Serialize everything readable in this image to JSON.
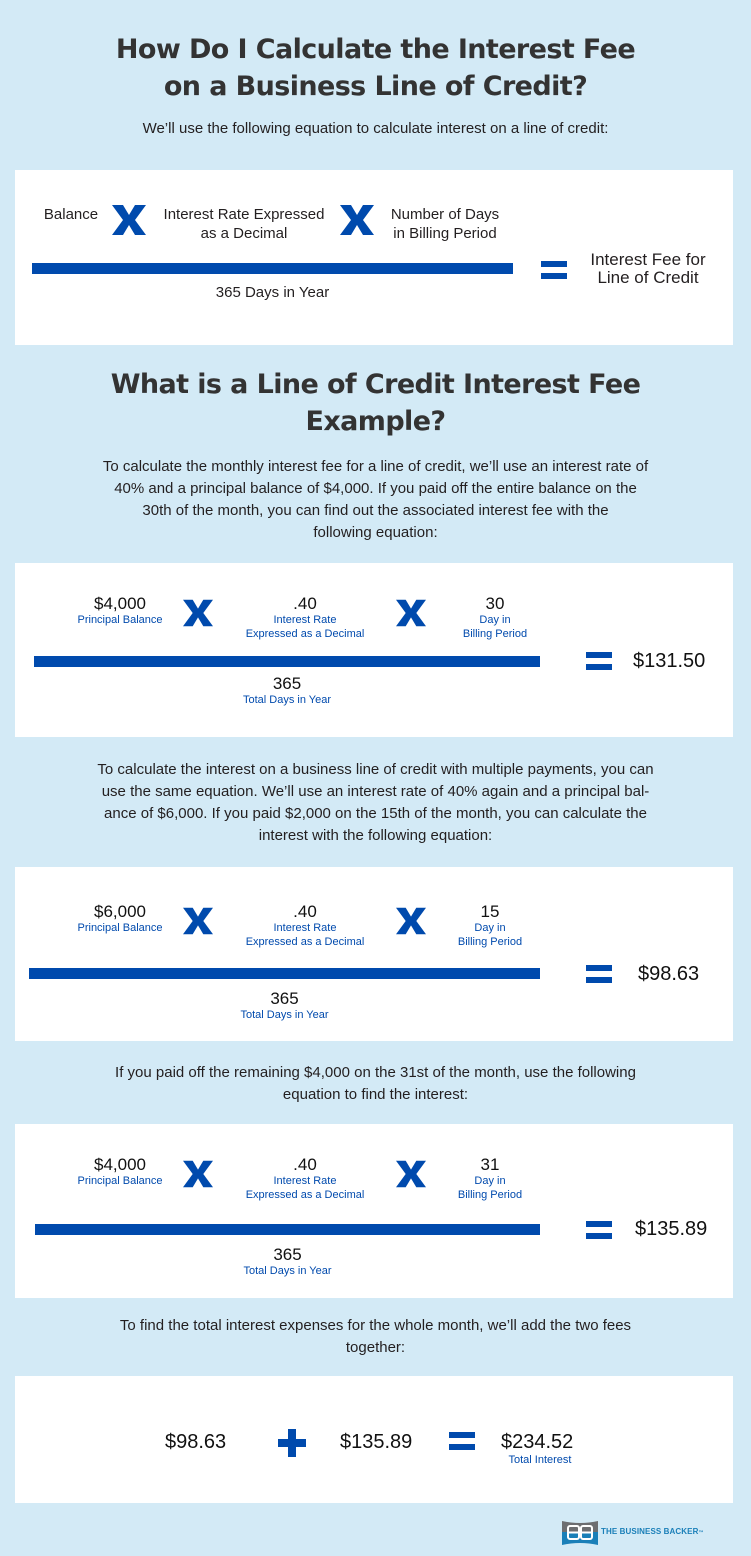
{
  "header": {
    "title_line1": "How Do I Calculate the Interest Fee",
    "title_line2": "on a Business Line of Credit?",
    "intro": "We’ll use the following equation to calculate interest on a line of credit:"
  },
  "formula": {
    "balance": "Balance",
    "rate_line1": "Interest Rate Expressed",
    "rate_line2": "as a Decimal",
    "days_line1": "Number of Days",
    "days_line2": "in Billing Period",
    "denominator": "365 Days in Year",
    "result_line1": "Interest Fee for",
    "result_line2": "Line of Credit"
  },
  "example_section": {
    "title_line1": "What is a Line of Credit Interest Fee",
    "title_line2": "Example?",
    "para1": [
      "To calculate the monthly interest fee for a line of credit, we’ll use an interest rate of",
      "40% and a principal balance of $4,000. If you paid off the entire balance on the",
      "30th of the month, you can find out the associated interest fee with the",
      "following equation:"
    ],
    "para2": [
      "To calculate the interest on a business line of credit with multiple payments, you can",
      "use the same equation. We’ll use an interest rate of 40% again and a principal bal-",
      "ance of $6,000. If you paid $2,000 on the 15th of the month, you can calculate the",
      "interest with the following equation:"
    ],
    "para3": [
      "If you paid off the remaining $4,000 on the 31st of the month, use the following",
      "equation to find the interest:"
    ],
    "para4": [
      "To find the total interest expenses for the whole month, we’ll add the two fees",
      "together:"
    ]
  },
  "labels": {
    "principal": "Principal Balance",
    "rate_line1": "Interest Rate",
    "rate_line2": "Expressed as a Decimal",
    "day_line1": "Day in",
    "day_line2": "Billing Period",
    "total_days": "Total Days in Year",
    "total_interest": "Total Interest"
  },
  "examples": [
    {
      "balance": "$4,000",
      "rate": ".40",
      "days": "30",
      "year_days": "365",
      "result": "$131.50"
    },
    {
      "balance": "$6,000",
      "rate": ".40",
      "days": "15",
      "year_days": "365",
      "result": "$98.63"
    },
    {
      "balance": "$4,000",
      "rate": ".40",
      "days": "31",
      "year_days": "365",
      "result": "$135.89"
    }
  ],
  "total": {
    "fee1": "$98.63",
    "fee2": "$135.89",
    "result": "$234.52"
  },
  "brand": {
    "name": "THE BUSINESS BACKER",
    "mark": "™",
    "accent_color": "#004aad",
    "background_color": "#d3eaf6"
  }
}
